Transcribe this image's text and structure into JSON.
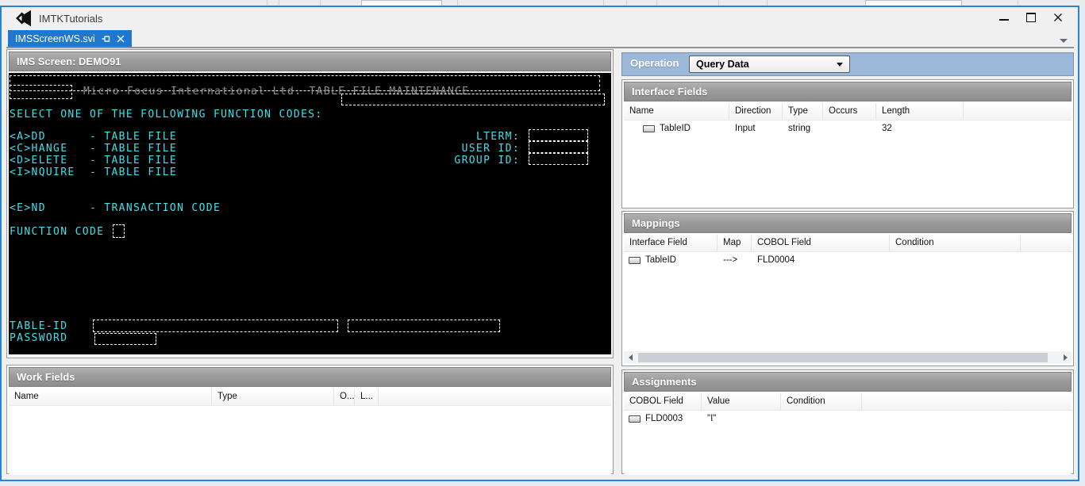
{
  "colors": {
    "tab_blue": "#1f78cd",
    "window_border_blue": "#2a83d2",
    "operation_bar_blue": "#9cb9da",
    "panel_header_gray": "#9b9b9b",
    "terminal_cyan": "#3fe0ea",
    "terminal_gray": "#8f8f8f"
  },
  "window": {
    "title": "IMTKTutorials"
  },
  "tab": {
    "label": "IMSScreenWS.svi"
  },
  "ims_screen": {
    "title": "IMS Screen: DEMO91",
    "terminal": {
      "banner": "Micro Focus International Ltd. TABLE FILE MAINTENANCE",
      "select_line": "SELECT ONE OF THE FOLLOWING FUNCTION CODES:",
      "function_codes": [
        "<A>DD      - TABLE FILE",
        "<C>HANGE   - TABLE FILE",
        "<D>ELETE   - TABLE FILE",
        "<I>NQUIRE  - TABLE FILE"
      ],
      "end_line": "<E>ND      - TRANSACTION CODE",
      "right_labels": [
        "LTERM:",
        "USER ID:",
        "GROUP ID:"
      ],
      "function_code_label": "FUNCTION CODE",
      "table_id_label": "TABLE-ID",
      "password_label": "PASSWORD"
    }
  },
  "work_fields": {
    "title": "Work Fields",
    "columns": [
      "Name",
      "Type",
      "O...",
      "L..."
    ]
  },
  "operation": {
    "label": "Operation",
    "value": "Query Data"
  },
  "interface_fields": {
    "title": "Interface Fields",
    "columns": [
      "Name",
      "Direction",
      "Type",
      "Occurs",
      "Length"
    ],
    "row": {
      "name": "TableID",
      "direction": "Input",
      "type": "string",
      "occurs": "",
      "length": "32"
    }
  },
  "mappings": {
    "title": "Mappings",
    "columns": [
      "Interface Field",
      "Map",
      "COBOL Field",
      "Condition"
    ],
    "row": {
      "interface_field": "TableID",
      "map": "--->",
      "cobol_field": "FLD0004",
      "condition": ""
    }
  },
  "assignments": {
    "title": "Assignments",
    "columns": [
      "COBOL Field",
      "Value",
      "Condition"
    ],
    "row": {
      "cobol_field": "FLD0003",
      "value": "\"I\"",
      "condition": ""
    }
  }
}
